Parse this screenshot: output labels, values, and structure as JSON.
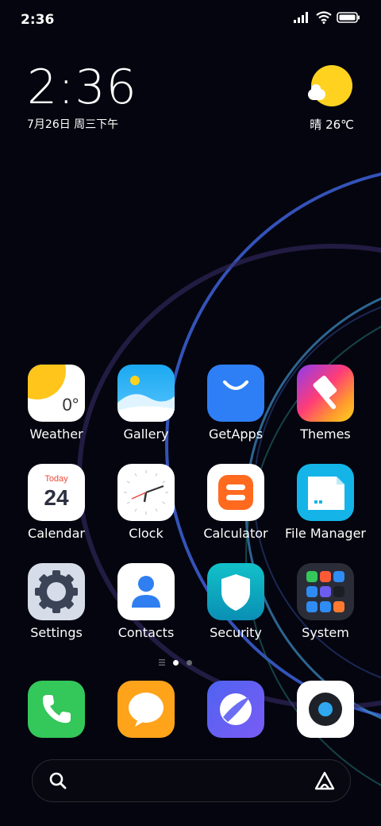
{
  "status_bar": {
    "time": "2:36",
    "icons": [
      "signal-icon",
      "wifi-icon",
      "battery-icon"
    ]
  },
  "clock_widget": {
    "time": "2:36",
    "date": "7月26日 周三下午"
  },
  "weather_widget": {
    "condition": "晴",
    "temperature": "26℃",
    "icon": "sun-cloud-icon"
  },
  "apps": [
    {
      "label": "Weather",
      "icon": "weather-icon"
    },
    {
      "label": "Gallery",
      "icon": "gallery-icon"
    },
    {
      "label": "GetApps",
      "icon": "getapps-icon"
    },
    {
      "label": "Themes",
      "icon": "themes-icon"
    },
    {
      "label": "Calendar",
      "icon": "calendar-icon",
      "badge_top": "Today",
      "badge_day": "24"
    },
    {
      "label": "Clock",
      "icon": "clock-icon"
    },
    {
      "label": "Calculator",
      "icon": "calculator-icon"
    },
    {
      "label": "File Manager",
      "icon": "file-manager-icon"
    },
    {
      "label": "Settings",
      "icon": "settings-icon"
    },
    {
      "label": "Contacts",
      "icon": "contacts-icon"
    },
    {
      "label": "Security",
      "icon": "security-icon"
    },
    {
      "label": "System",
      "icon": "system-folder-icon"
    }
  ],
  "weather_app_temp": "0°",
  "page_indicator": {
    "pages": 2,
    "current": 1
  },
  "dock": [
    {
      "name": "phone",
      "icon": "phone-icon"
    },
    {
      "name": "messages",
      "icon": "messages-icon"
    },
    {
      "name": "browser",
      "icon": "browser-icon"
    },
    {
      "name": "camera",
      "icon": "camera-icon"
    }
  ],
  "search_bar": {
    "left_icon": "search-icon",
    "right_icon": "assistant-icon"
  },
  "colors": {
    "background": "#05050f",
    "accent_blue": "#3d6bd6",
    "sun": "#ffd21f"
  }
}
